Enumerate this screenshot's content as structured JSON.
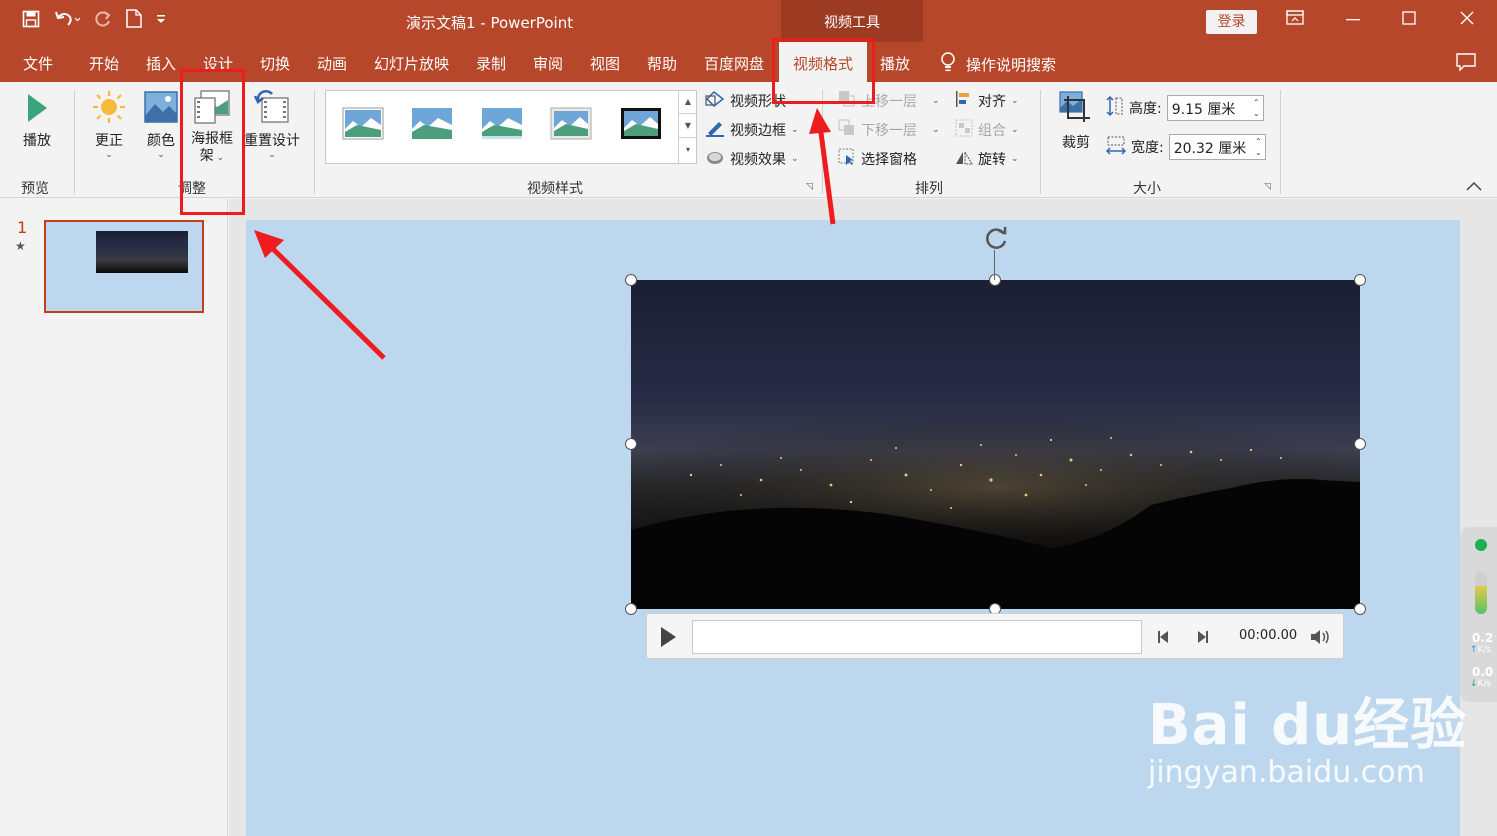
{
  "window": {
    "title": "演示文稿1  -  PowerPoint",
    "context_tab_group": "视频工具",
    "login_label": "登录"
  },
  "menu": {
    "items": [
      "文件",
      "开始",
      "插入",
      "设计",
      "切换",
      "动画",
      "幻灯片放映",
      "录制",
      "审阅",
      "视图",
      "帮助",
      "百度网盘"
    ],
    "active": "视频格式",
    "after_active": "播放",
    "search": "操作说明搜索"
  },
  "ribbon": {
    "preview": {
      "play_label": "播放",
      "group": "预览"
    },
    "adjust": {
      "correct_label": "更正",
      "color_label": "颜色",
      "poster_label_1": "海报框",
      "poster_label_2": "架",
      "reset_label": "重置设计",
      "group": "调整"
    },
    "video_styles": {
      "shape_label": "视频形状",
      "border_label": "视频边框",
      "effects_label": "视频效果",
      "group": "视频样式"
    },
    "arrange": {
      "bring_forward": "上移一层",
      "send_backward": "下移一层",
      "selection_pane": "选择窗格",
      "align": "对齐",
      "group_label": "组合",
      "rotate": "旋转",
      "group": "排列"
    },
    "size": {
      "crop_label": "裁剪",
      "height_label": "高度:",
      "height_value": "9.15 厘米",
      "width_label": "宽度:",
      "width_value": "20.32 厘米",
      "group": "大小"
    }
  },
  "slides": {
    "number": "1",
    "marker": "★"
  },
  "player": {
    "time": "00:00.00"
  },
  "speed_widget": {
    "upload": "0.2",
    "download": "0.0",
    "unit": "K/s"
  },
  "watermark": {
    "main": "Bai du经验",
    "sub": "jingyan.baidu.com"
  },
  "colors": {
    "accent": "#b7472a",
    "slide_bg": "#bdd7ee",
    "annotation": "#ee1c1c"
  }
}
